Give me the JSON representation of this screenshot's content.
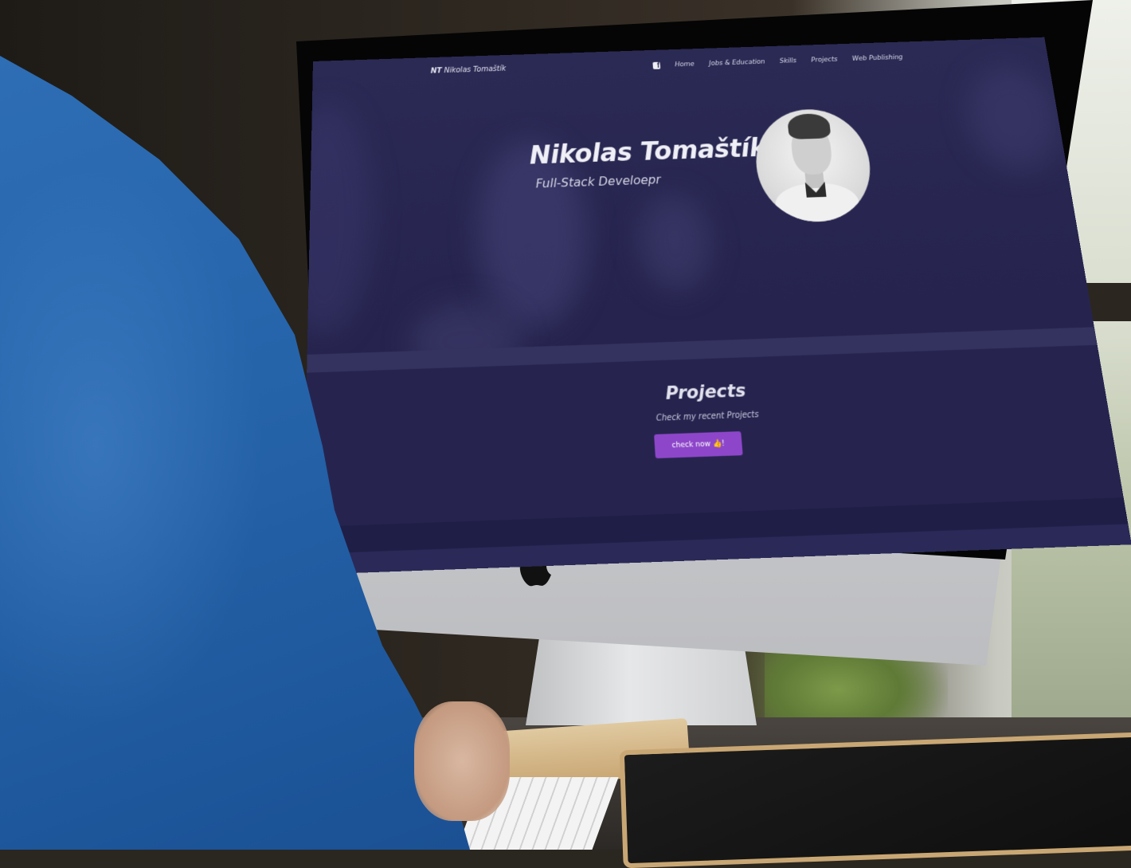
{
  "site": {
    "brand_mark": "NT",
    "brand_name": "Nikolas Tomaštík",
    "nav": {
      "home": "Home",
      "jobs": "Jobs & Education",
      "skills": "Skills",
      "projects": "Projects",
      "publishing": "Web Publishing"
    },
    "hero": {
      "name": "Nikolas Tomaštík",
      "role": "Full-Stack Develoepr"
    },
    "projects_section": {
      "title": "Projects",
      "subtitle": "Check my recent Projects",
      "button_label": "check now 👍!"
    }
  },
  "colors": {
    "screen_bg": "#26244e",
    "button": "#8d46c9",
    "sweater": "#2563a9"
  },
  "icons": [
    "facebook-icon",
    "apple-logo"
  ]
}
